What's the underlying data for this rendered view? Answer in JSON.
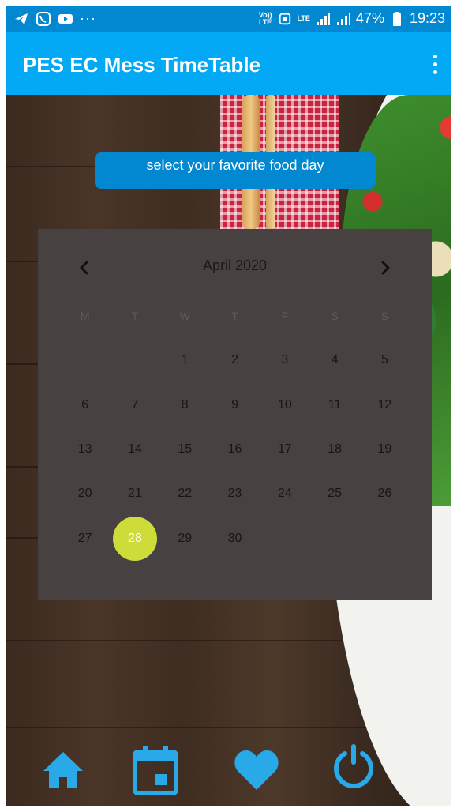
{
  "status_bar": {
    "left_icons": [
      "telegram-icon",
      "viber-icon",
      "youtube-icon"
    ],
    "overflow_dots": "···",
    "volte_label": "Vo))\nLTE",
    "lte_label": "LTE",
    "battery_percent": "47%",
    "time": "19:23"
  },
  "app_bar": {
    "title": "PES EC Mess TimeTable",
    "menu_icon": "more-vertical-icon"
  },
  "banner": {
    "text": "select your favorite food day"
  },
  "calendar": {
    "month_label": "April 2020",
    "prev_icon": "chevron-left-icon",
    "next_icon": "chevron-right-icon",
    "weekdays": [
      "M",
      "T",
      "W",
      "T",
      "F",
      "S",
      "S"
    ],
    "leading_blanks": 2,
    "days": [
      "1",
      "2",
      "3",
      "4",
      "5",
      "6",
      "7",
      "8",
      "9",
      "10",
      "11",
      "12",
      "13",
      "14",
      "15",
      "16",
      "17",
      "18",
      "19",
      "20",
      "21",
      "22",
      "23",
      "24",
      "25",
      "26",
      "27",
      "28",
      "29",
      "30"
    ],
    "selected_day": "28",
    "colors": {
      "panel": "#474241",
      "selected": "#cddc39"
    }
  },
  "bottom_nav": {
    "items": [
      {
        "icon": "home-icon"
      },
      {
        "icon": "calendar-icon"
      },
      {
        "icon": "heart-icon"
      },
      {
        "icon": "power-icon"
      }
    ],
    "color": "#29a9e8"
  },
  "colors": {
    "status_bar": "#0288d1",
    "app_bar": "#03a9f4",
    "banner": "#0288d1"
  }
}
